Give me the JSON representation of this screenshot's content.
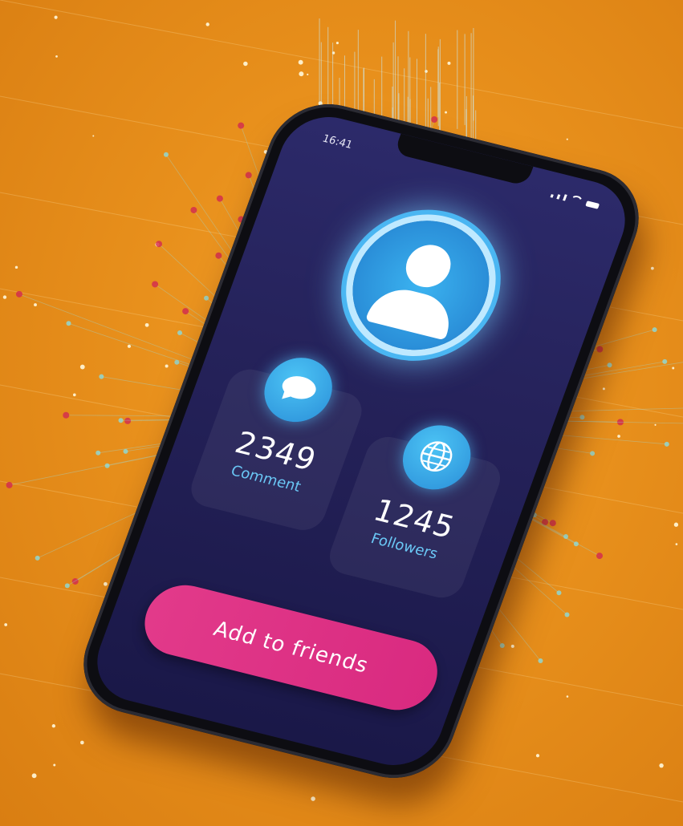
{
  "status_bar": {
    "time": "16:41"
  },
  "stats": {
    "comment": {
      "value": "2349",
      "label": "Comment",
      "icon": "chat-bubble-icon"
    },
    "followers": {
      "value": "1245",
      "label": "Followers",
      "icon": "globe-icon"
    }
  },
  "profile": {
    "icon": "user-avatar-icon"
  },
  "actions": {
    "add_friend_label": "Add to friends"
  },
  "colors": {
    "background": "#e8901c",
    "screen": "#25225a",
    "accent_blue": "#2a8ed8",
    "label_blue": "#6ac7f5",
    "button_pink": "#e23a8a"
  }
}
